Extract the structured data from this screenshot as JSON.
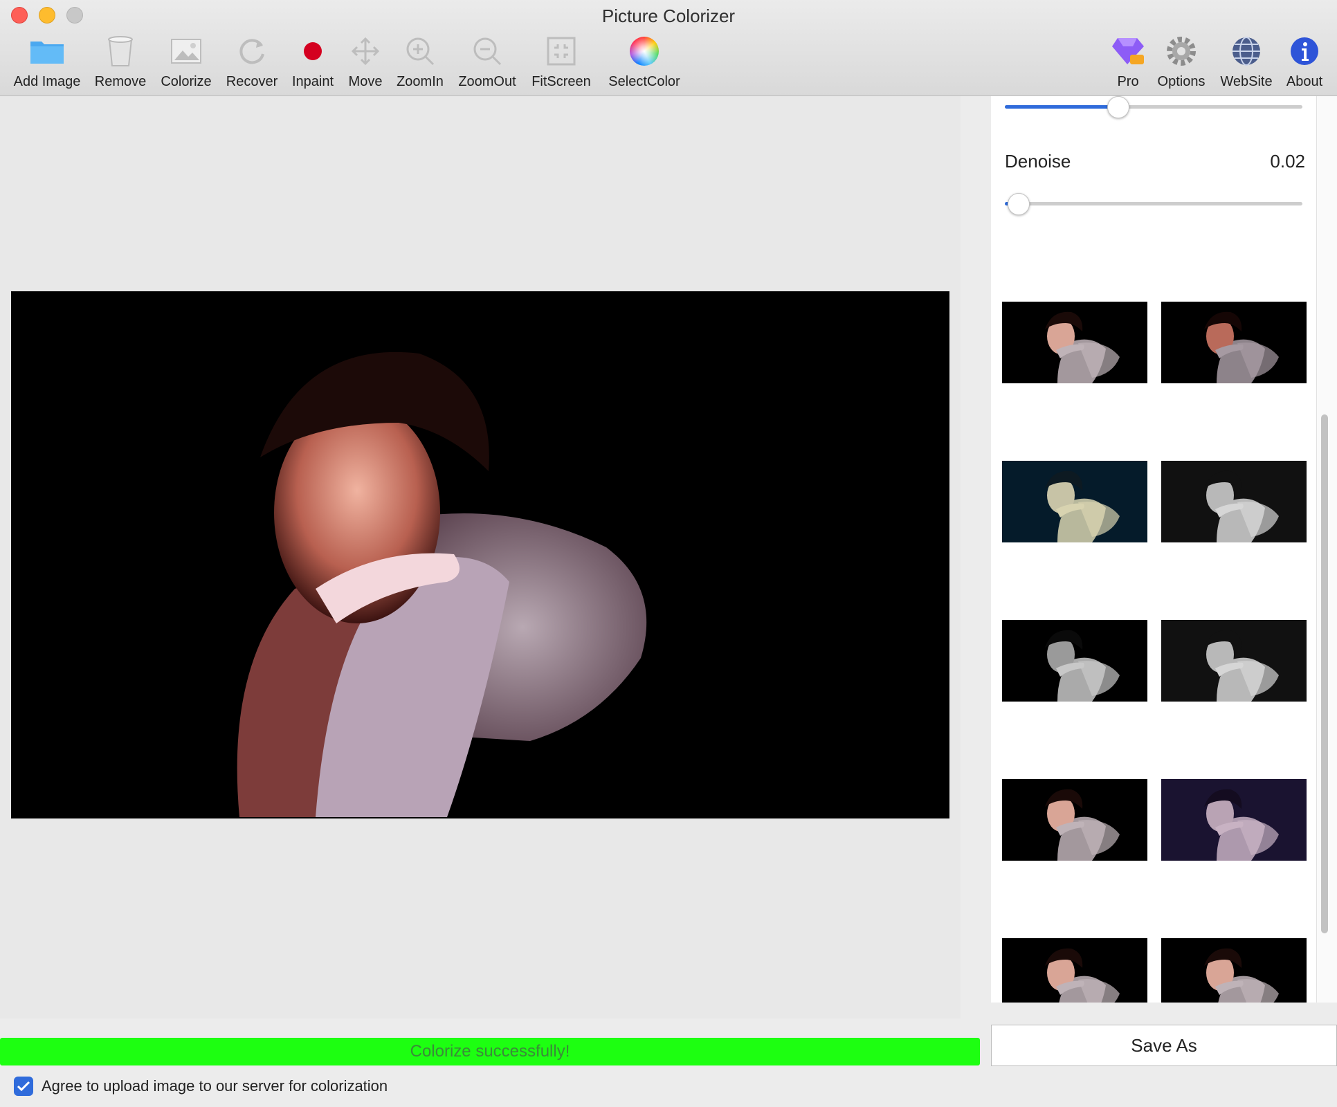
{
  "window": {
    "title": "Picture Colorizer"
  },
  "toolbar": {
    "add_image": "Add Image",
    "remove": "Remove",
    "colorize": "Colorize",
    "recover": "Recover",
    "inpaint": "Inpaint",
    "move": "Move",
    "zoom_in": "ZoomIn",
    "zoom_out": "ZoomOut",
    "fit_screen": "FitScreen",
    "select_color": "SelectColor",
    "pro": "Pro",
    "options": "Options",
    "website": "WebSite",
    "about": "About"
  },
  "icons": {
    "add_image": "folder-icon",
    "remove": "trash-icon",
    "colorize": "image-icon",
    "recover": "refresh-icon",
    "inpaint": "red-dot-icon",
    "move": "move-arrows-icon",
    "zoom_in": "zoom-in-icon",
    "zoom_out": "zoom-out-icon",
    "fit_screen": "fit-screen-icon",
    "select_color": "color-wheel-icon",
    "pro": "gem-icon",
    "options": "gear-icon",
    "website": "globe-icon",
    "about": "info-icon"
  },
  "sliders": {
    "top": {
      "fraction": 0.38
    },
    "denoise": {
      "label": "Denoise",
      "value": "0.02",
      "fraction": 0.02
    }
  },
  "status": {
    "message": "Colorize successfully!"
  },
  "actions": {
    "save_as": "Save As"
  },
  "agreement": {
    "checked": true,
    "label": "Agree to upload image to our server for colorization"
  },
  "colors": {
    "accent": "#2f6bdb",
    "status_bar": "#1dff11",
    "status_text": "#3b8a3a",
    "close": "#fe5f57",
    "minimize": "#febc2e"
  },
  "thumbnails": [
    {
      "tint": "warm"
    },
    {
      "tint": "warm-dark"
    },
    {
      "tint": "teal"
    },
    {
      "tint": "grayscale"
    },
    {
      "tint": "grayscale-dark"
    },
    {
      "tint": "grayscale"
    },
    {
      "tint": "warm"
    },
    {
      "tint": "purple"
    },
    {
      "tint": "warm"
    },
    {
      "tint": "warm"
    }
  ]
}
